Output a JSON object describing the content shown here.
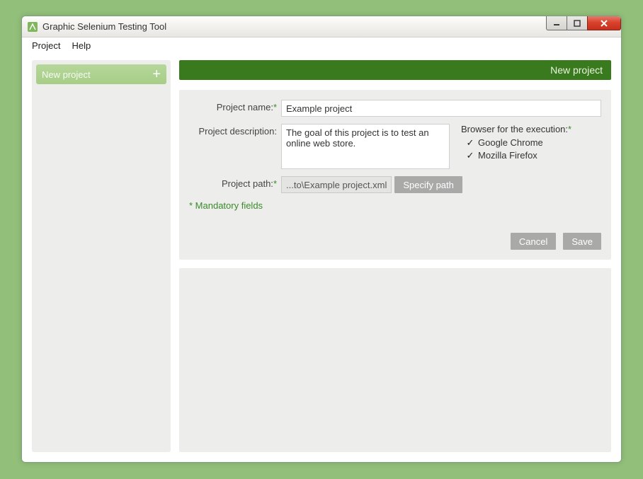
{
  "window": {
    "title": "Graphic Selenium Testing Tool"
  },
  "menubar": {
    "project": "Project",
    "help": "Help"
  },
  "sidebar": {
    "newProject": "New project"
  },
  "header": {
    "title": "New project"
  },
  "labels": {
    "projectName": "Project name:",
    "projectDescription": "Project description:",
    "projectPath": "Project path:",
    "browsersTitle": "Browser for the execution:",
    "mandatory": "* Mandatory fields"
  },
  "fields": {
    "projectName": "Example project",
    "projectDescription": "The goal of this project is to test an online web store.",
    "projectPath": "...to\\Example project.xml"
  },
  "browsers": {
    "chrome": {
      "label": "Google Chrome",
      "checked": true
    },
    "firefox": {
      "label": "Mozilla Firefox",
      "checked": true
    }
  },
  "buttons": {
    "specifyPath": "Specify path",
    "cancel": "Cancel",
    "save": "Save"
  }
}
